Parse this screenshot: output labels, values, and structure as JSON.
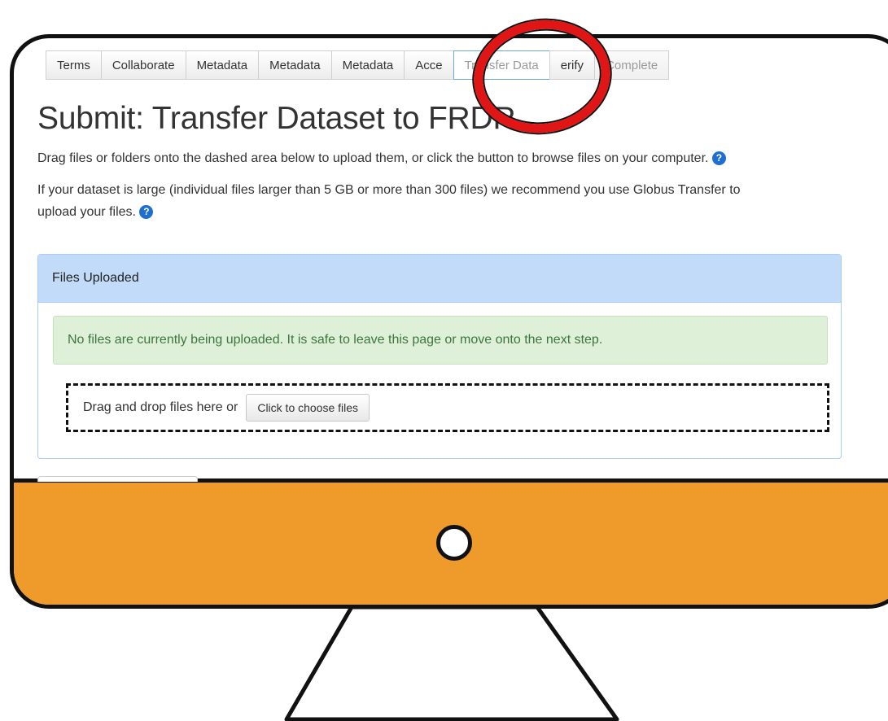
{
  "tabs": [
    {
      "label": "Terms",
      "state": "normal"
    },
    {
      "label": "Collaborate",
      "state": "normal"
    },
    {
      "label": "Metadata",
      "state": "normal"
    },
    {
      "label": "Metadata",
      "state": "normal"
    },
    {
      "label": "Metadata",
      "state": "normal"
    },
    {
      "label": "Acce",
      "state": "normal"
    },
    {
      "label": "Transfer Data",
      "state": "active"
    },
    {
      "label": "erify",
      "state": "normal"
    },
    {
      "label": "Complete",
      "state": "disabled"
    }
  ],
  "page": {
    "title": "Submit: Transfer Dataset to FRDR",
    "intro": "Drag files or folders onto the dashed area below to upload them, or click the button to browse files on your computer.",
    "large_note_line1": "If your dataset is large (individual files larger than 5 GB or more than 300 files) we recommend you use Globus Transfer to",
    "large_note_line2": "upload your files.",
    "help_glyph": "?"
  },
  "panel": {
    "heading": "Files Uploaded",
    "status": "No files are currently being uploaded. It is safe to leave this page or move onto the next step.",
    "drop_text": "Drag and drop files here or",
    "choose_button": "Click to choose files"
  },
  "colors": {
    "monitor_chin": "#ef9b2c",
    "annotation_circle": "#e01515",
    "panel_header": "#c1dbf8",
    "alert_bg": "#def0d8",
    "alert_text": "#3c763d",
    "help_icon": "#1f6fd0"
  }
}
